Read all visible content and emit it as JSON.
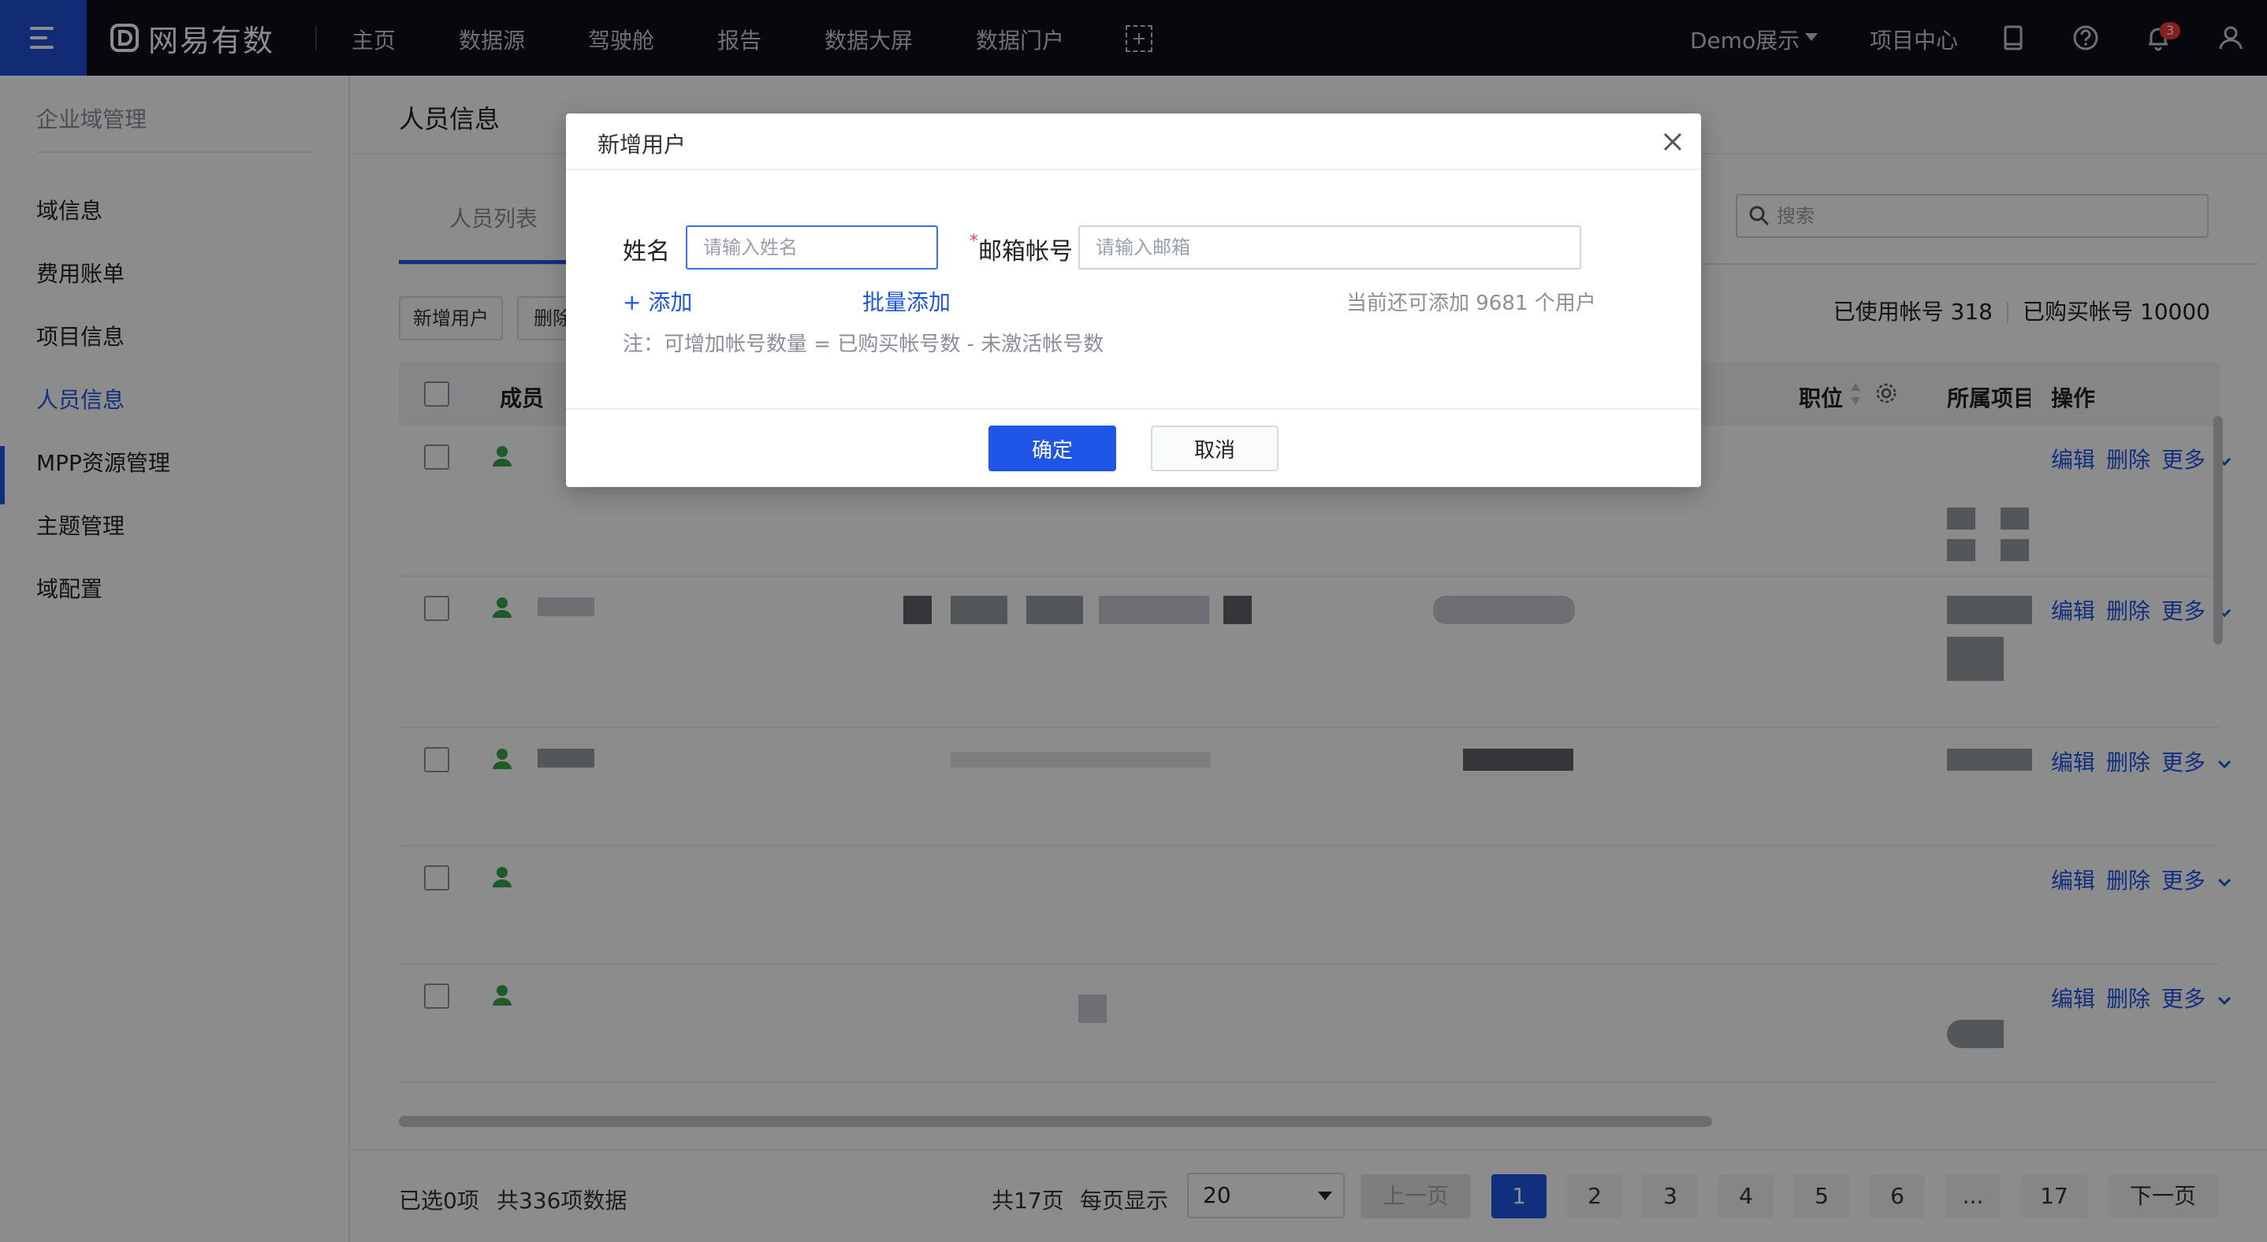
{
  "topnav": {
    "brand": "网易有数",
    "items": [
      "主页",
      "数据源",
      "驾驶舱",
      "报告",
      "数据大屏",
      "数据门户"
    ],
    "demo_label": "Demo展示",
    "project_center": "项目中心",
    "notification_count": "3",
    "icons": [
      "menu-icon",
      "brand-logo-icon",
      "add-screen-icon",
      "caret-down-icon",
      "doc-icon",
      "help-icon",
      "bell-icon",
      "user-icon"
    ]
  },
  "sidebar": {
    "title": "企业域管理",
    "items": [
      "域信息",
      "费用账单",
      "项目信息",
      "人员信息",
      "MPP资源管理",
      "主题管理",
      "域配置"
    ],
    "active": "人员信息"
  },
  "main": {
    "title": "人员信息",
    "tab": "人员列表",
    "search_placeholder": "搜索",
    "add_user": "新增用户",
    "delete": "删除",
    "used_accounts": "已使用帐号 318",
    "purchased_accounts": "已购买帐号 10000",
    "columns": {
      "member": "成员",
      "position": "职位",
      "project": "所属项目",
      "actions": "操作"
    },
    "row_actions": {
      "edit": "编辑",
      "delete": "删除",
      "more": "更多"
    }
  },
  "footer": {
    "selected": "已选0项",
    "total": "共336项数据",
    "pages_total": "共17页",
    "per_page_label": "每页显示",
    "per_page": "20",
    "prev": "上一页",
    "pages": [
      "1",
      "2",
      "3",
      "4",
      "5",
      "6",
      "...",
      "17"
    ],
    "current_page": "1",
    "next": "下一页"
  },
  "modal": {
    "title": "新增用户",
    "name_label": "姓名",
    "name_placeholder": "请输入姓名",
    "email_required_mark": "*",
    "email_label": "邮箱帐号",
    "email_placeholder": "请输入邮箱",
    "add_link": "+ 添加",
    "batch_add": "批量添加",
    "remaining": "当前还可添加 9681 个用户",
    "note": "注：可增加帐号数量 = 已购买帐号数 - 未激活帐号数",
    "confirm": "确定",
    "cancel": "取消"
  },
  "colors": {
    "accent": "#1f56e8",
    "topbar": "#0b0f19",
    "user_icon": "#3aa64a",
    "badge": "#ef3b3b"
  }
}
